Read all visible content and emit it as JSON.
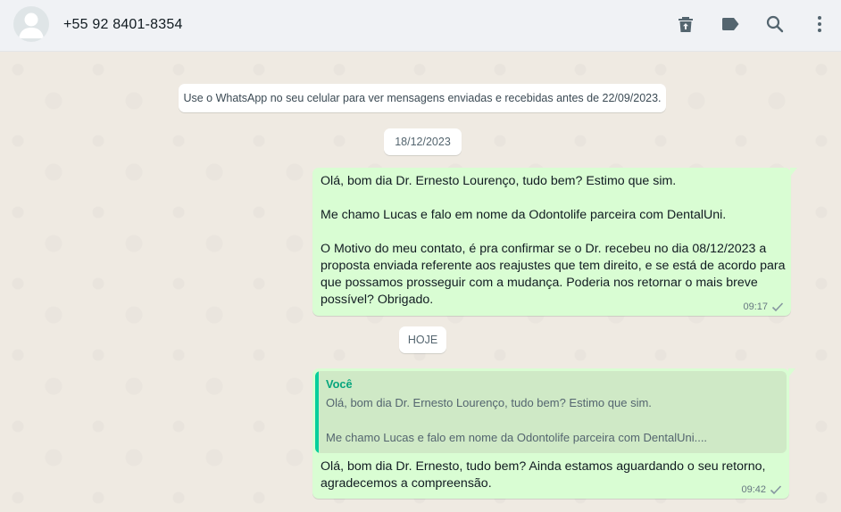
{
  "header": {
    "contact_name": "+55 92 8401-8354",
    "icons": [
      "delete-icon",
      "label-icon",
      "search-icon",
      "menu-icon"
    ]
  },
  "chat": {
    "system_note": "Use o WhatsApp no seu celular para ver mensagens enviadas e recebidas antes de 22/09/2023.",
    "date_1": "18/12/2023",
    "message_1": {
      "text": "Olá, bom dia Dr. Ernesto Lourenço, tudo bem? Estimo que sim.\n\nMe chamo Lucas e falo em nome da Odontolife parceira com DentalUni.\n\nO Motivo do meu contato, é pra confirmar se o Dr. recebeu no dia 08/12/2023 a\nproposta enviada referente aos reajustes que tem direito, e se está de acordo para\nque possamos prosseguir com a mudança. Poderia nos retornar o mais breve\npossível? Obrigado.",
      "time": "09:17"
    },
    "date_2": "HOJE",
    "message_2": {
      "quote_author": "Você",
      "quote_text": "Olá, bom dia Dr. Ernesto Lourenço, tudo bem? Estimo que sim.\n\nMe chamo Lucas e falo em nome da Odontolife parceira com DentalUni....",
      "text": "Olá, bom dia Dr. Ernesto, tudo bem? Ainda estamos aguardando o seu retorno,\nagradecemos a compreensão.",
      "time": "09:42"
    }
  },
  "colors": {
    "outgoing_bubble": "#d9fdd3",
    "quote_accent": "#06cf9c",
    "header_bg": "#f0f2f5",
    "chat_bg": "#efeae2"
  }
}
